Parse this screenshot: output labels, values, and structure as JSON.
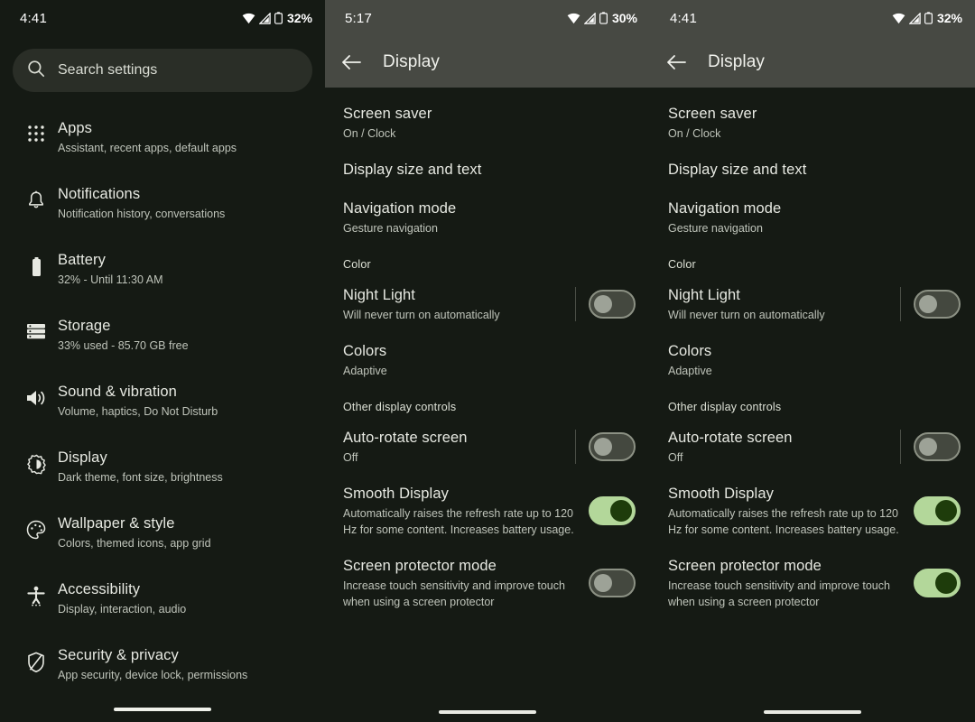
{
  "panels": [
    {
      "id": "settings-home",
      "status": {
        "time": "4:41",
        "battery": "32%",
        "wifi_icon": "wifi-icon",
        "signal_icon": "cell-signal-icon",
        "battery_icon": "battery-icon"
      },
      "search": {
        "placeholder": "Search settings",
        "icon": "search-icon"
      },
      "items": [
        {
          "icon": "apps-grid-icon",
          "title": "Apps",
          "subtitle": "Assistant, recent apps, default apps"
        },
        {
          "icon": "bell-icon",
          "title": "Notifications",
          "subtitle": "Notification history, conversations"
        },
        {
          "icon": "battery-icon",
          "title": "Battery",
          "subtitle": "32% - Until 11:30 AM"
        },
        {
          "icon": "storage-icon",
          "title": "Storage",
          "subtitle": "33% used - 85.70 GB free"
        },
        {
          "icon": "sound-icon",
          "title": "Sound & vibration",
          "subtitle": "Volume, haptics, Do Not Disturb"
        },
        {
          "icon": "brightness-icon",
          "title": "Display",
          "subtitle": "Dark theme, font size, brightness"
        },
        {
          "icon": "palette-icon",
          "title": "Wallpaper & style",
          "subtitle": "Colors, themed icons, app grid"
        },
        {
          "icon": "accessibility-icon",
          "title": "Accessibility",
          "subtitle": "Display, interaction, audio"
        },
        {
          "icon": "shield-icon",
          "title": "Security & privacy",
          "subtitle": "App security, device lock, permissions"
        }
      ]
    },
    {
      "id": "display-settings-a",
      "status": {
        "time": "5:17",
        "battery": "30%",
        "wifi_icon": "wifi-icon",
        "signal_icon": "cell-signal-icon",
        "battery_icon": "battery-icon"
      },
      "appbar": {
        "back_icon": "back-arrow-icon",
        "title": "Display"
      },
      "rows": [
        {
          "kind": "item",
          "title": "Screen saver",
          "subtitle": "On / Clock"
        },
        {
          "kind": "item",
          "title": "Display size and text",
          "subtitle": ""
        },
        {
          "kind": "item",
          "title": "Navigation mode",
          "subtitle": "Gesture navigation"
        },
        {
          "kind": "section",
          "title": "Color"
        },
        {
          "kind": "toggle",
          "title": "Night Light",
          "subtitle": "Will never turn on automatically",
          "state": "off"
        },
        {
          "kind": "item",
          "title": "Colors",
          "subtitle": "Adaptive"
        },
        {
          "kind": "section",
          "title": "Other display controls"
        },
        {
          "kind": "toggle",
          "title": "Auto-rotate screen",
          "subtitle": "Off",
          "state": "off"
        },
        {
          "kind": "toggle",
          "title": "Smooth Display",
          "subtitle": "Automatically raises the refresh rate up to 120 Hz for some content. Increases battery usage.",
          "state": "on"
        },
        {
          "kind": "toggle",
          "title": "Screen protector mode",
          "subtitle": "Increase touch sensitivity and improve touch when using a screen protector",
          "state": "off"
        }
      ]
    },
    {
      "id": "display-settings-b",
      "status": {
        "time": "4:41",
        "battery": "32%",
        "wifi_icon": "wifi-icon",
        "signal_icon": "cell-signal-icon",
        "battery_icon": "battery-icon"
      },
      "appbar": {
        "back_icon": "back-arrow-icon",
        "title": "Display"
      },
      "rows": [
        {
          "kind": "item",
          "title": "Screen saver",
          "subtitle": "On / Clock"
        },
        {
          "kind": "item",
          "title": "Display size and text",
          "subtitle": ""
        },
        {
          "kind": "item",
          "title": "Navigation mode",
          "subtitle": "Gesture navigation"
        },
        {
          "kind": "section",
          "title": "Color"
        },
        {
          "kind": "toggle",
          "title": "Night Light",
          "subtitle": "Will never turn on automatically",
          "state": "off"
        },
        {
          "kind": "item",
          "title": "Colors",
          "subtitle": "Adaptive"
        },
        {
          "kind": "section",
          "title": "Other display controls"
        },
        {
          "kind": "toggle",
          "title": "Auto-rotate screen",
          "subtitle": "Off",
          "state": "off"
        },
        {
          "kind": "toggle",
          "title": "Smooth Display",
          "subtitle": "Automatically raises the refresh rate up to 120 Hz for some content. Increases battery usage.",
          "state": "on"
        },
        {
          "kind": "toggle",
          "title": "Screen protector mode",
          "subtitle": "Increase touch sensitivity and improve touch when using a screen protector",
          "state": "on"
        }
      ]
    }
  ],
  "colors": {
    "background": "#151A14",
    "appbar": "#474943",
    "searchbar": "#2A2E27",
    "toggle_on_track": "#B3D79A",
    "toggle_on_thumb": "#1E3C0B",
    "toggle_off_track": "#44483F",
    "toggle_off_thumb": "#9DA297",
    "primary_text": "#E7E9E2",
    "secondary_text": "#BFC4BA"
  }
}
